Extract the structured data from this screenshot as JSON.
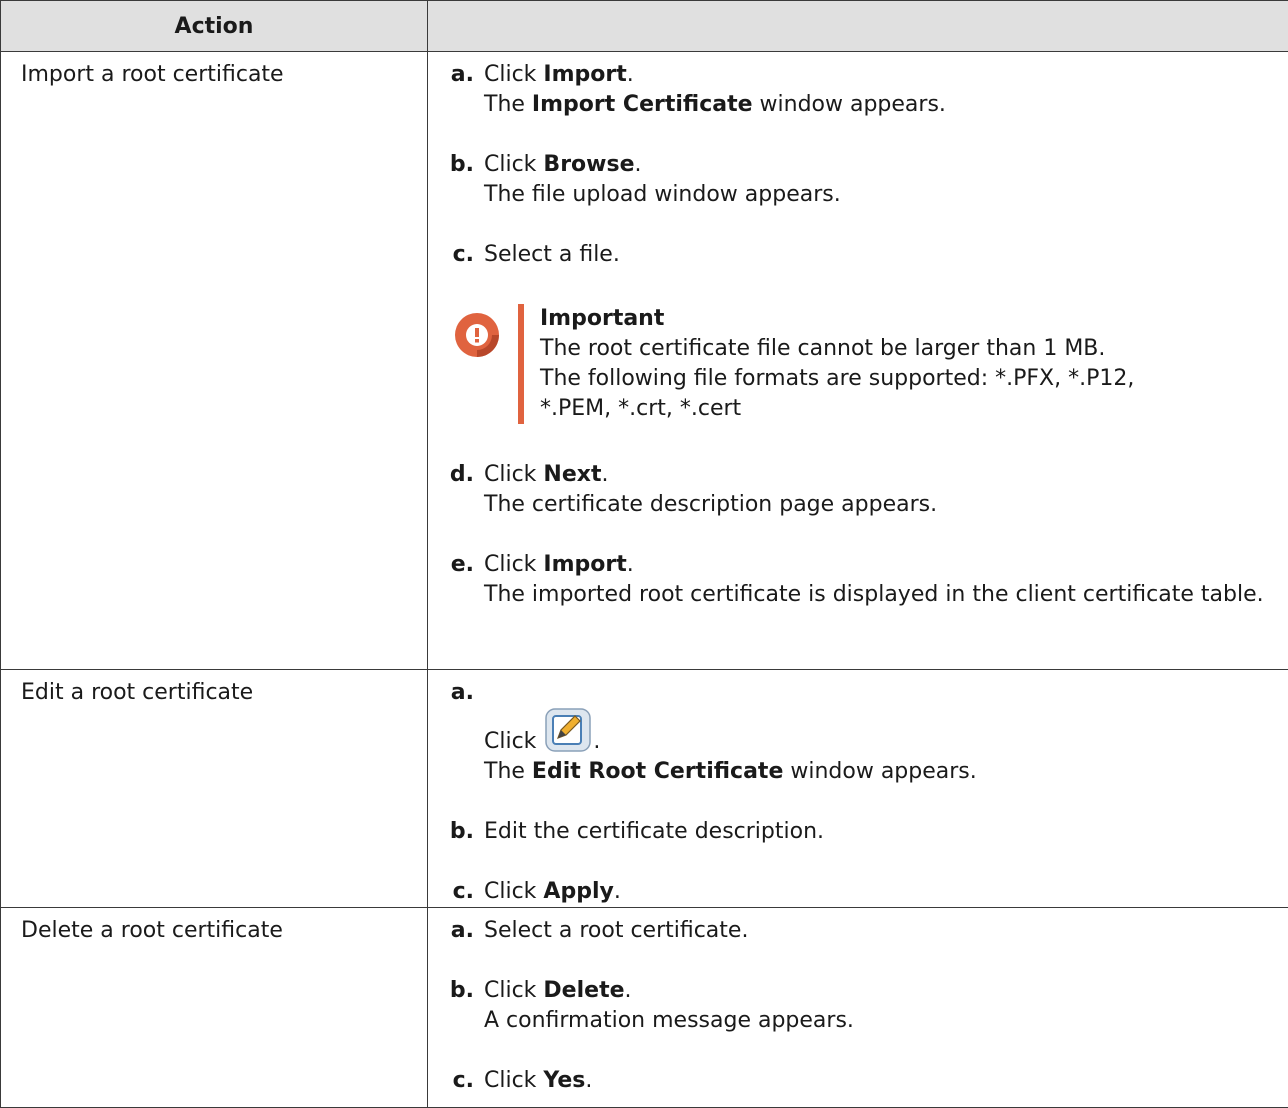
{
  "header": {
    "action": "Action",
    "blank": ""
  },
  "rows": [
    {
      "action": "Import a root certificate",
      "steps": [
        {
          "letter": "a.",
          "pre": "Click ",
          "bold": "Import",
          "post": ".",
          "line2_pre": "The ",
          "line2_bold": "Import Certificate",
          "line2_post": " window appears."
        },
        {
          "letter": "b.",
          "pre": "Click ",
          "bold": "Browse",
          "post": ".",
          "line2": "The file upload window appears."
        },
        {
          "letter": "c.",
          "text": "Select a file."
        },
        {
          "letter": "d.",
          "pre": "Click ",
          "bold": "Next",
          "post": ".",
          "line2": "The certificate description page appears."
        },
        {
          "letter": "e.",
          "pre": "Click ",
          "bold": "Import",
          "post": ".",
          "line2": "The imported root certificate is displayed in the client certificate table."
        }
      ],
      "note": {
        "title": "Important",
        "line1": "The root certificate file cannot be larger than 1 MB.",
        "line2": "The following file formats are supported: *.PFX, *.P12, *.PEM, *.crt, *.cert"
      }
    },
    {
      "action": "Edit a root certificate",
      "steps": [
        {
          "letter": "a.",
          "pre": "Click ",
          "post": ".",
          "line2_pre": "The ",
          "line2_bold": "Edit Root Certificate",
          "line2_post": " window appears."
        },
        {
          "letter": "b.",
          "text": "Edit the certificate description."
        },
        {
          "letter": "c.",
          "pre": "Click ",
          "bold": "Apply",
          "post": "."
        }
      ]
    },
    {
      "action": "Delete a root certificate",
      "steps": [
        {
          "letter": "a.",
          "text": "Select a root certificate."
        },
        {
          "letter": "b.",
          "pre": "Click ",
          "bold": "Delete",
          "post": ".",
          "line2": "A confirmation message appears."
        },
        {
          "letter": "c.",
          "pre": "Click ",
          "bold": "Yes",
          "post": "."
        }
      ]
    }
  ],
  "colors": {
    "accent": "#e0633f",
    "header_bg": "#e0e0e0",
    "border": "#3a3a3a"
  }
}
